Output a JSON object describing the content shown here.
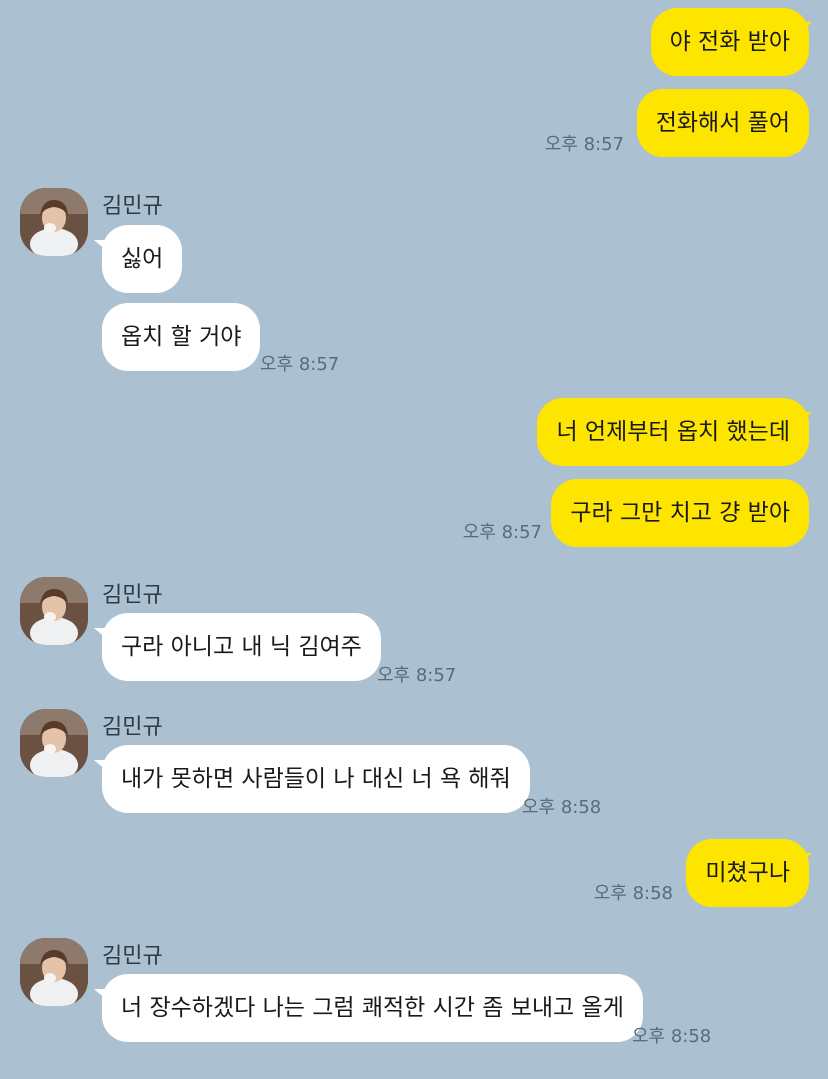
{
  "chat": {
    "contact_name": "김민규",
    "messages": [
      {
        "sender": "me",
        "text": "야 전화 받아",
        "time": ""
      },
      {
        "sender": "me",
        "text": "전화해서 풀어",
        "time": "오후 8:57"
      },
      {
        "sender": "other",
        "text": "싫어",
        "time": ""
      },
      {
        "sender": "other",
        "text": "옵치 할 거야",
        "time": "오후 8:57"
      },
      {
        "sender": "me",
        "text": "너 언제부터 옵치 했는데",
        "time": ""
      },
      {
        "sender": "me",
        "text": "구라 그만 치고 걍 받아",
        "time": "오후 8:57"
      },
      {
        "sender": "other",
        "text": "구라 아니고 내 닉 김여주",
        "time": "오후 8:57"
      },
      {
        "sender": "other",
        "text": "내가 못하면 사람들이 나 대신 너 욕 해줘",
        "time": "오후 8:58"
      },
      {
        "sender": "me",
        "text": "미쳤구나",
        "time": "오후 8:58"
      },
      {
        "sender": "other",
        "text": "너 장수하겠다 나는 그럼 쾌적한 시간 좀 보내고 올게",
        "time": "오후 8:58"
      }
    ]
  },
  "colors": {
    "background": "#abc1d1",
    "my_bubble": "#fee500",
    "other_bubble": "#ffffff",
    "timestamp": "#5b6b78"
  },
  "icons": {
    "avatar": "profile-photo"
  }
}
